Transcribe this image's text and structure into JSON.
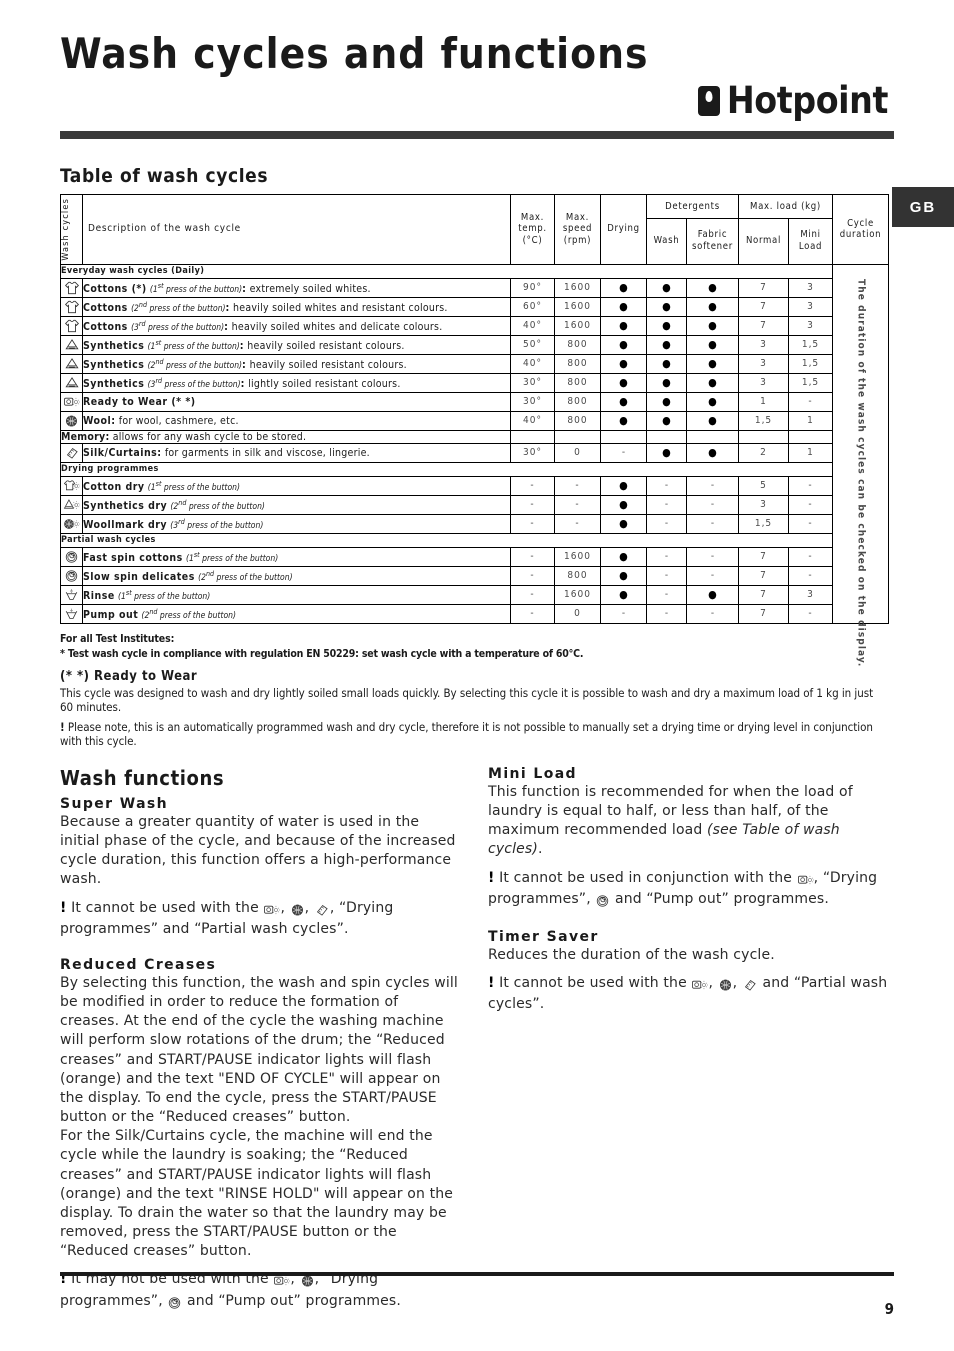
{
  "header": {
    "title": "Wash cycles and functions",
    "brand": "Hotpoint",
    "locale_badge": "GB"
  },
  "table_section": {
    "heading": "Table of wash cycles",
    "vertical_header": "Wash cycles",
    "columns": {
      "description": "Description of the wash cycle",
      "max_temp": "Max. temp. (°C)",
      "max_temp_l1": "Max.",
      "max_temp_l2": "temp.",
      "max_temp_l3": "(°C)",
      "max_speed_l1": "Max.",
      "max_speed_l2": "speed",
      "max_speed_l3": "(rpm)",
      "drying": "Drying",
      "detergents": "Detergents",
      "wash": "Wash",
      "fabric_softener_l1": "Fabric",
      "fabric_softener_l2": "softener",
      "max_load": "Max. load (kg)",
      "normal": "Normal",
      "mini_l1": "Mini",
      "mini_l2": "Load",
      "cycle_duration_l1": "Cycle",
      "cycle_duration_l2": "duration"
    },
    "duration_note": "The duration of the wash cycles can be checked on the display.",
    "groups": [
      {
        "label": "Everyday wash cycles (Daily)",
        "rows": [
          {
            "icon": "tshirt-icon",
            "name": "Cottons (*)",
            "press": "(1st press of the button)",
            "press_sup": "st",
            "press_pre": "(1",
            "press_post": " press of the button)",
            "sep": ":",
            "desc": " extremely soiled whites.",
            "temp": "90°",
            "speed": "1600",
            "drying": "•",
            "wash": "•",
            "softener": "•",
            "normal": "7",
            "mini": "3"
          },
          {
            "icon": "tshirt-icon",
            "name": "Cottons",
            "press_pre": "(2",
            "press_sup": "nd",
            "press_post": " press of the button)",
            "sep": ":",
            "desc": " heavily soiled whites and resistant colours.",
            "temp": "60°",
            "speed": "1600",
            "drying": "•",
            "wash": "•",
            "softener": "•",
            "normal": "7",
            "mini": "3"
          },
          {
            "icon": "tshirt-icon",
            "name": "Cottons",
            "press_pre": "(3",
            "press_sup": "rd",
            "press_post": " press of the button)",
            "sep": ":",
            "desc": " heavily soiled whites and delicate colours.",
            "temp": "40°",
            "speed": "1600",
            "drying": "•",
            "wash": "•",
            "softener": "•",
            "normal": "7",
            "mini": "3"
          },
          {
            "icon": "synthetics-icon",
            "name": "Synthetics",
            "press_pre": "(1",
            "press_sup": "st",
            "press_post": " press of the button)",
            "sep": ":",
            "desc": " heavily soiled resistant colours.",
            "temp": "50°",
            "speed": "800",
            "drying": "•",
            "wash": "•",
            "softener": "•",
            "normal": "3",
            "mini": "1,5"
          },
          {
            "icon": "synthetics-icon",
            "name": "Synthetics",
            "press_pre": "(2",
            "press_sup": "nd",
            "press_post": " press of the button)",
            "sep": ":",
            "desc": " heavily soiled resistant colours.",
            "temp": "40°",
            "speed": "800",
            "drying": "•",
            "wash": "•",
            "softener": "•",
            "normal": "3",
            "mini": "1,5"
          },
          {
            "icon": "synthetics-icon",
            "name": "Synthetics",
            "press_pre": "(3",
            "press_sup": "rd",
            "press_post": " press of the button)",
            "sep": ":",
            "desc": " lightly soiled resistant colours.",
            "temp": "30°",
            "speed": "800",
            "drying": "•",
            "wash": "•",
            "softener": "•",
            "normal": "3",
            "mini": "1,5"
          },
          {
            "icon": "ready-to-wear-icon",
            "name": "Ready to Wear (* *)",
            "press_pre": "",
            "press_sup": "",
            "press_post": "",
            "sep": "",
            "desc": "",
            "temp": "30°",
            "speed": "800",
            "drying": "•",
            "wash": "•",
            "softener": "•",
            "normal": "1",
            "mini": "-"
          },
          {
            "icon": "wool-icon",
            "name": "Wool:",
            "press_pre": "",
            "press_sup": "",
            "press_post": "",
            "sep": "",
            "desc": " for wool, cashmere, etc.",
            "temp": "40°",
            "speed": "800",
            "drying": "•",
            "wash": "•",
            "softener": "•",
            "normal": "1,5",
            "mini": "1"
          },
          {
            "icon": "",
            "memory": true,
            "name": "Memory:",
            "desc": " allows for any wash cycle to be stored.",
            "temp": "",
            "speed": "",
            "drying": "",
            "wash": "",
            "softener": "",
            "normal": "",
            "mini": ""
          },
          {
            "icon": "silk-icon",
            "name": "Silk/Curtains:",
            "press_pre": "",
            "press_sup": "",
            "press_post": "",
            "sep": "",
            "desc": " for garments in silk and viscose, lingerie.",
            "temp": "30°",
            "speed": "0",
            "drying": "-",
            "wash": "•",
            "softener": "•",
            "normal": "2",
            "mini": "1"
          }
        ]
      },
      {
        "label": "Drying programmes",
        "rows": [
          {
            "icon": "cotton-dry-icon",
            "name": "Cotton dry",
            "press_pre": "(1",
            "press_sup": "st",
            "press_post": " press of the button)",
            "sep": "",
            "desc": "",
            "temp": "-",
            "speed": "-",
            "drying": "•",
            "wash": "-",
            "softener": "-",
            "normal": "5",
            "mini": "-"
          },
          {
            "icon": "synthetics-dry-icon",
            "name": "Synthetics dry",
            "press_pre": "(2",
            "press_sup": "nd",
            "press_post": " press of the button)",
            "sep": "",
            "desc": "",
            "temp": "-",
            "speed": "-",
            "drying": "•",
            "wash": "-",
            "softener": "-",
            "normal": "3",
            "mini": "-"
          },
          {
            "icon": "woolmark-dry-icon",
            "name": "Woollmark dry",
            "press_pre": "(3",
            "press_sup": "rd",
            "press_post": " press of the button)",
            "sep": "",
            "desc": "",
            "temp": "-",
            "speed": "-",
            "drying": "•",
            "wash": "-",
            "softener": "-",
            "normal": "1,5",
            "mini": "-"
          }
        ]
      },
      {
        "label": "Partial wash cycles",
        "rows": [
          {
            "icon": "spin-icon",
            "name": "Fast spin cottons",
            "press_pre": "(1",
            "press_sup": "st",
            "press_post": " press of the button)",
            "sep": "",
            "desc": "",
            "temp": "-",
            "speed": "1600",
            "drying": "•",
            "wash": "-",
            "softener": "-",
            "normal": "7",
            "mini": "-"
          },
          {
            "icon": "spin-icon",
            "name": "Slow spin delicates",
            "press_pre": "(2",
            "press_sup": "nd",
            "press_post": " press of the button)",
            "sep": "",
            "desc": "",
            "temp": "-",
            "speed": "800",
            "drying": "•",
            "wash": "-",
            "softener": "-",
            "normal": "7",
            "mini": "-"
          },
          {
            "icon": "rinse-icon",
            "name": "Rinse",
            "press_pre": "(1",
            "press_sup": "st",
            "press_post": " press of the button)",
            "sep": "",
            "desc": "",
            "temp": "-",
            "speed": "1600",
            "drying": "•",
            "wash": "-",
            "softener": "•",
            "normal": "7",
            "mini": "3"
          },
          {
            "icon": "pump-out-icon",
            "name": "Pump out",
            "press_pre": "(2",
            "press_sup": "nd",
            "press_post": " press of the button)",
            "sep": "",
            "desc": "",
            "temp": "-",
            "speed": "0",
            "drying": "-",
            "wash": "-",
            "softener": "-",
            "normal": "7",
            "mini": "-"
          }
        ]
      }
    ]
  },
  "notes": {
    "institutes": "For all Test Institutes:",
    "star_note": "* Test wash cycle in compliance with regulation EN 50229: set wash cycle with a temperature of 60°C.",
    "rtw_heading": "(* *) Ready to Wear",
    "rtw_body": "This cycle was designed to wash and dry lightly soiled small loads quickly. By selecting this cycle it is possible to wash and dry a maximum load of 1 kg in just 60 minutes.",
    "rtw_warning_bang": "!",
    "rtw_warning": " Please note, this is an automatically programmed wash and dry cycle, therefore it is not possible to manually set a drying time or drying level in conjunction with this cycle."
  },
  "functions": {
    "heading": "Wash functions",
    "left": [
      {
        "title": "Super Wash",
        "body": "Because a greater quantity of water is used in the initial phase of the cycle, and because of the increased cycle duration, this function offers a high-performance wash.",
        "warn_pre": " It cannot be used with the ",
        "warn_icons": [
          "ready-to-wear-icon",
          "wool-icon",
          "silk-icon"
        ],
        "warn_post": ", “Drying programmes” and “Partial wash cycles”."
      },
      {
        "title": "Reduced Creases",
        "body": "By selecting this function, the wash and spin cycles will be modified in order to reduce the formation of creases. At the end of the cycle the washing machine will perform slow rotations of the drum; the “Reduced creases” and START/PAUSE indicator lights will flash (orange) and the text \"END OF CYCLE\" will appear on the display. To end the cycle, press the START/PAUSE button or the “Reduced creases” button.",
        "body2": "For the Silk/Curtains cycle, the machine will end the cycle while the laundry is soaking; the “Reduced creases” and START/PAUSE indicator lights will flash (orange) and the text \"RINSE HOLD\" will appear on the display. To drain the water so that the laundry may be removed, press the START/PAUSE button or the “Reduced creases” button.",
        "warn_pre": " It may not be used with the ",
        "warn_mid": ", “Drying programmes”, ",
        "warn_post": " and “Pump out” programmes."
      }
    ],
    "right": [
      {
        "title": "Mini Load",
        "body_pre": "This function is recommended for when the load of laundry is equal to half, or less than half, of the maximum recommended load ",
        "body_italic": "(see Table of wash cycles)",
        "body_post": ".",
        "warn_pre": " It cannot be used in conjunction with the ",
        "warn_mid": ", “Drying programmes”, ",
        "warn_post": " and “Pump out” programmes."
      },
      {
        "title": "Timer Saver",
        "body": "Reduces the duration of the wash cycle.",
        "warn_pre": " It cannot be used with the ",
        "warn_post": " and “Partial wash cycles”."
      }
    ]
  },
  "footer": {
    "page_number": "9"
  }
}
